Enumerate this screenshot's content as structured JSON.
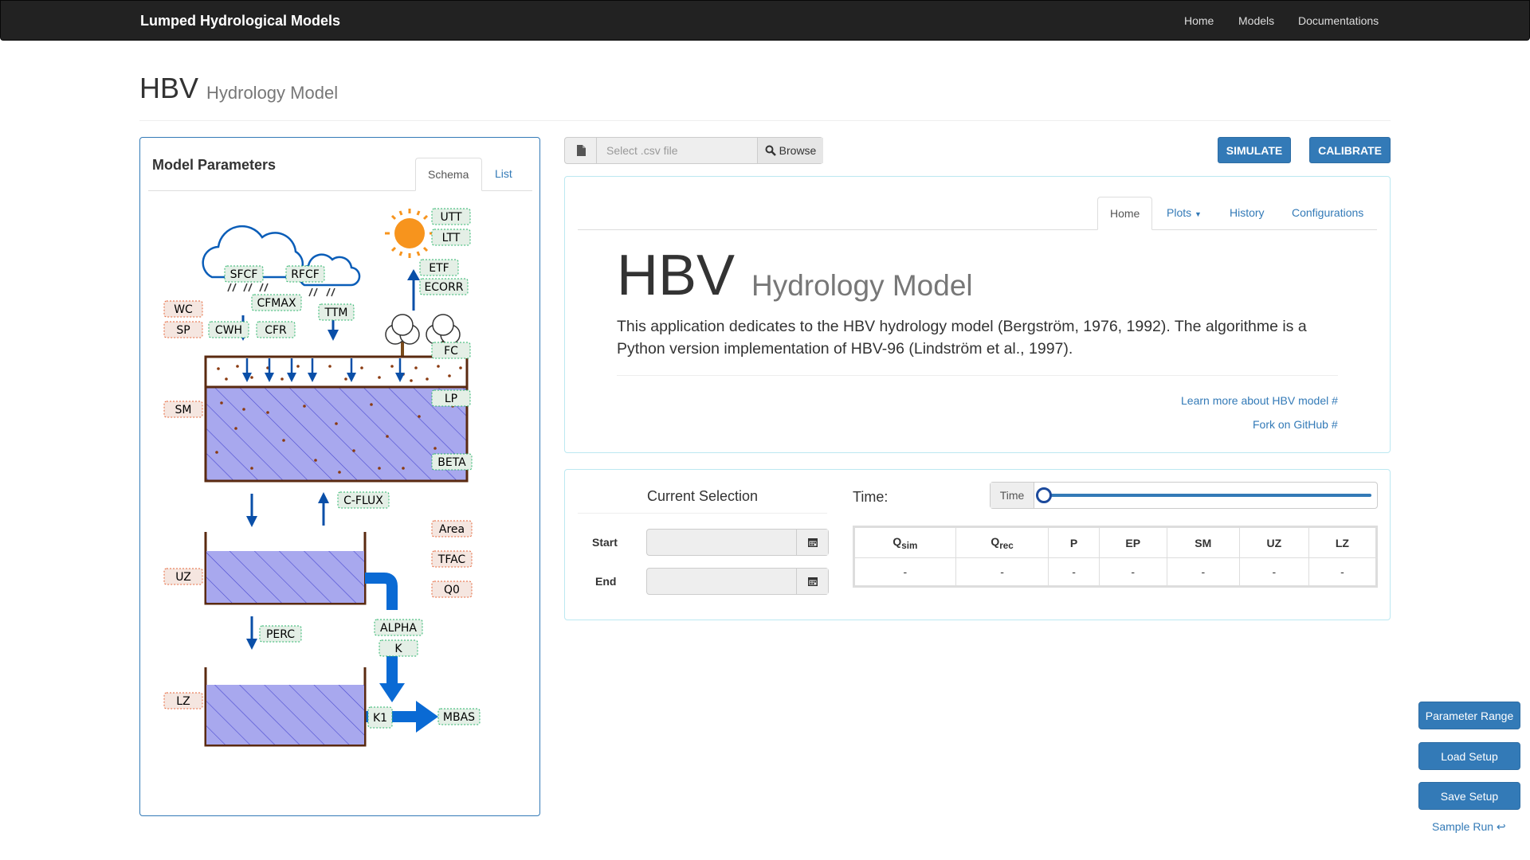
{
  "navbar": {
    "brand": "Lumped Hydrological Models",
    "links": [
      "Home",
      "Models",
      "Documentations"
    ]
  },
  "header": {
    "title": "HBV",
    "subtitle": "Hydrology Model"
  },
  "left_panel": {
    "title": "Model Parameters",
    "tabs": [
      "Schema",
      "List"
    ],
    "active_tab": "Schema",
    "schema_labels": {
      "utt": "UTT",
      "ltt": "LTT",
      "etf": "ETF",
      "ecorr": "ECORR",
      "sfcf": "SFCF",
      "rfcf": "RFCF",
      "cfmax": "CFMAX",
      "ttm": "TTM",
      "wc": "WC",
      "sp": "SP",
      "cwh": "CWH",
      "cfr": "CFR",
      "fc": "FC",
      "sm": "SM",
      "lp": "LP",
      "beta": "BETA",
      "cflux": "C-FLUX",
      "area": "Area",
      "tfac": "TFAC",
      "q0": "Q0",
      "uz": "UZ",
      "alpha": "ALPHA",
      "k": "K",
      "perc": "PERC",
      "lz": "LZ",
      "k1": "K1",
      "mbas": "MBAS"
    }
  },
  "file": {
    "placeholder": "Select .csv file",
    "browse": "Browse"
  },
  "actions": {
    "simulate": "SIMULATE",
    "calibrate": "CALIBRATE"
  },
  "info_panel": {
    "tabs": [
      "Home",
      "Plots",
      "History",
      "Configurations"
    ],
    "active_tab": "Home",
    "title": "HBV",
    "subtitle": "Hydrology Model",
    "lead": "This application dedicates to the HBV hydrology model (Bergström, 1976, 1992). The algorithme is a Python version implementation of HBV-96 (Lindström et al., 1997).",
    "learn_more": "Learn more about HBV model #",
    "fork": "Fork on GitHub #"
  },
  "selection": {
    "title": "Current Selection",
    "start_label": "Start",
    "end_label": "End",
    "start_value": "",
    "end_value": "",
    "time_label": "Time:",
    "slider_addon": "Time",
    "slider_position": 0
  },
  "results_table": {
    "headers": [
      {
        "main": "Q",
        "sub": "sim"
      },
      {
        "main": "Q",
        "sub": "rec"
      },
      {
        "main": "P",
        "sub": ""
      },
      {
        "main": "EP",
        "sub": ""
      },
      {
        "main": "SM",
        "sub": ""
      },
      {
        "main": "UZ",
        "sub": ""
      },
      {
        "main": "LZ",
        "sub": ""
      }
    ],
    "row": [
      "-",
      "-",
      "-",
      "-",
      "-",
      "-",
      "-"
    ]
  },
  "side_buttons": {
    "parameter_range": "Parameter Range",
    "load_setup": "Load Setup",
    "save_setup": "Save Setup",
    "sample_run": "Sample Run ↩"
  },
  "colors": {
    "primary": "#337ab7",
    "navbar": "#222222",
    "reservoir": "#a8a8ee",
    "flow_arrow": "#0a5db8",
    "param_green": "#2ab56b",
    "param_red": "#e5663a",
    "sun": "#f7941d"
  }
}
